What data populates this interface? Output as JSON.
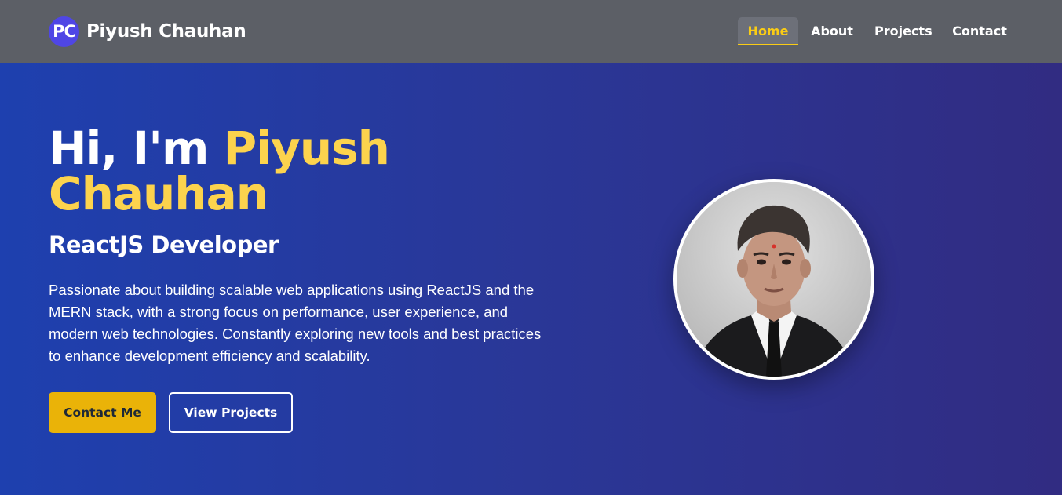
{
  "brand": {
    "logo_text": "PC",
    "name": "Piyush Chauhan"
  },
  "nav": {
    "items": [
      {
        "label": "Home",
        "active": true
      },
      {
        "label": "About",
        "active": false
      },
      {
        "label": "Projects",
        "active": false
      },
      {
        "label": "Contact",
        "active": false
      }
    ]
  },
  "hero": {
    "greeting": "Hi, I'm",
    "name": "Piyush Chauhan",
    "role": "ReactJS Developer",
    "description": "Passionate about building scalable web applications using ReactJS and the MERN stack, with a strong focus on performance, user experience, and modern web technologies. Constantly exploring new tools and best practices to enhance development efficiency and scalability.",
    "primary_button": "Contact Me",
    "secondary_button": "View Projects",
    "avatar": "profile-photo"
  },
  "colors": {
    "nav_bg": "#5c5f66",
    "accent_yellow": "#facc15",
    "logo_bg": "#4f46e5",
    "button_primary": "#eab308",
    "hero_gradient_start": "#1e40af",
    "hero_gradient_end": "#312c82"
  }
}
